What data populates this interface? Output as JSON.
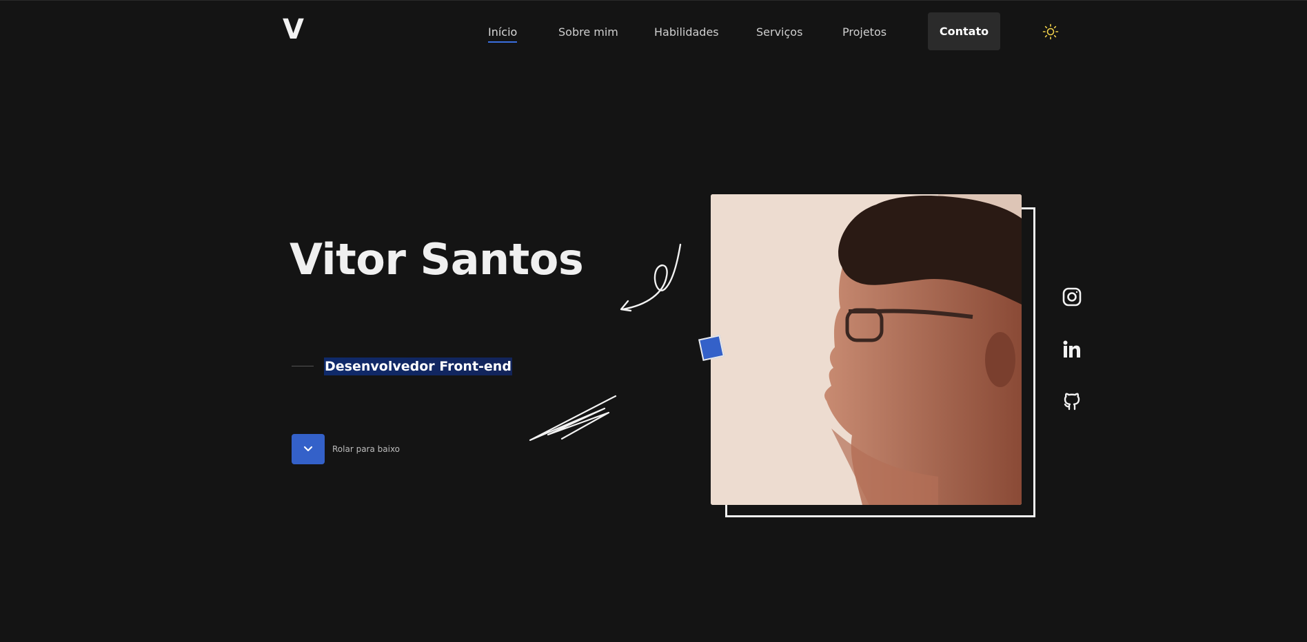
{
  "header": {
    "logo": "V",
    "nav": [
      "Início",
      "Sobre mim",
      "Habilidades",
      "Serviços",
      "Projetos"
    ],
    "active_nav": "Início",
    "contact_label": "Contato",
    "theme_icon": "sun-icon"
  },
  "hero": {
    "name": "Vitor Santos",
    "subtitle": "Desenvolvedor Front-end",
    "scroll_label": "Rolar para baixo"
  },
  "socials": [
    "instagram-icon",
    "linkedin-icon",
    "github-icon"
  ],
  "colors": {
    "background": "#141414",
    "accent": "#3461c9",
    "contact_button": "#2b2b2b",
    "sun": "#f2d24b"
  }
}
